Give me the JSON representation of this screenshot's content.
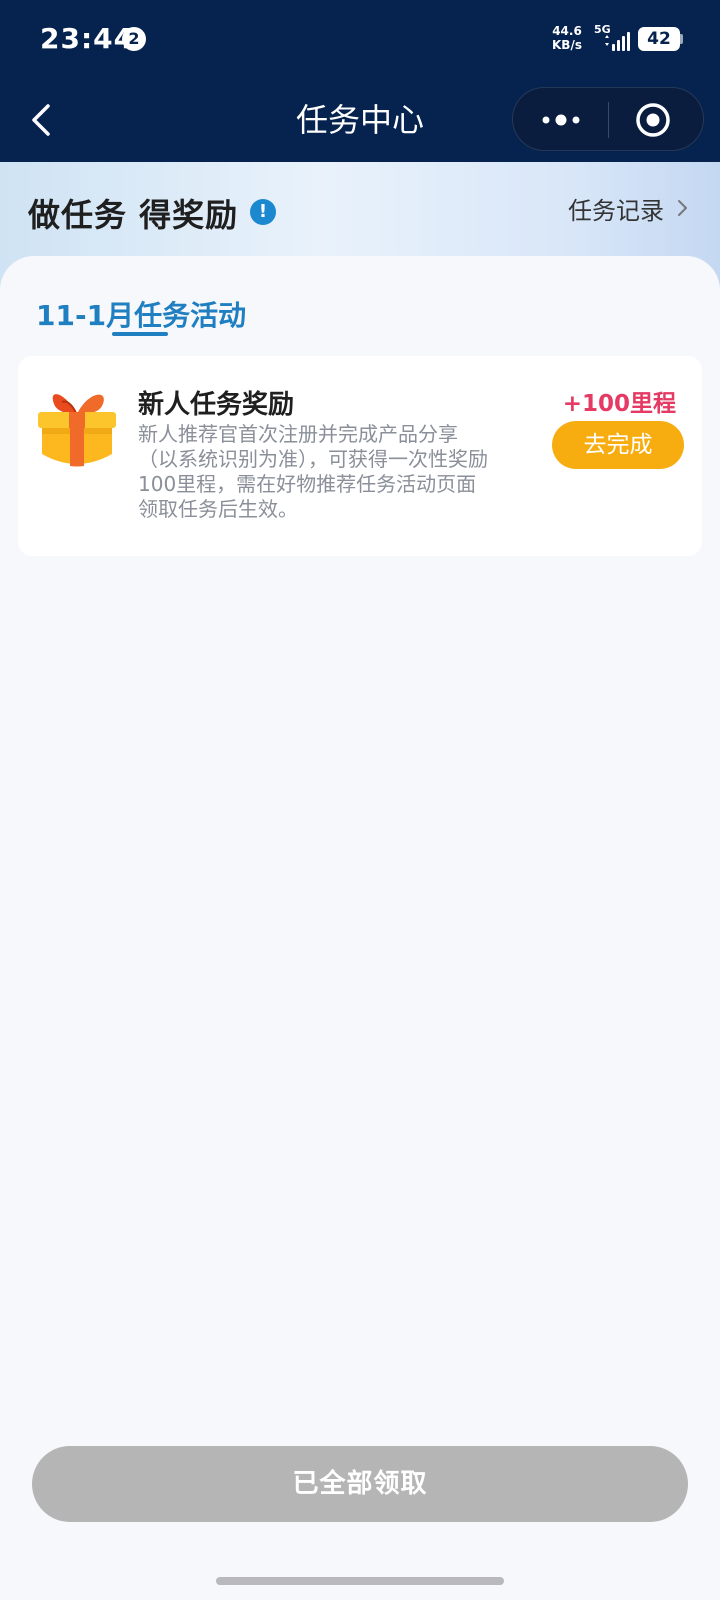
{
  "status_bar": {
    "time": "23:44",
    "notification_count": "2",
    "net_speed_value": "44.6",
    "net_speed_unit": "KB/s",
    "network_type": "5G",
    "battery_level": "42"
  },
  "nav": {
    "title": "任务中心",
    "back_icon": "chevron-left-icon",
    "more_icon": "more-dots-icon",
    "close_icon": "target-circle-icon"
  },
  "header": {
    "title": "做任务 得奖励",
    "info_glyph": "!",
    "record_link": "任务记录"
  },
  "tabs": [
    {
      "label": "11-1月任务活动",
      "active": true
    }
  ],
  "tasks": [
    {
      "icon": "gift-box-icon",
      "title": "新人任务奖励",
      "description": "新人推荐官首次注册并完成产品分享（以系统识别为准），可获得一次性奖励100里程，需在好物推荐任务活动页面领取任务后生效。",
      "reward": "+100里程",
      "action_label": "去完成"
    }
  ],
  "footer": {
    "claim_all_label": "已全部领取"
  },
  "colors": {
    "nav_bg": "#06224f",
    "accent_blue": "#1f7fc1",
    "reward_red": "#e53a63",
    "action_orange": "#f7ac10",
    "disabled_gray": "#b5b5b5"
  }
}
